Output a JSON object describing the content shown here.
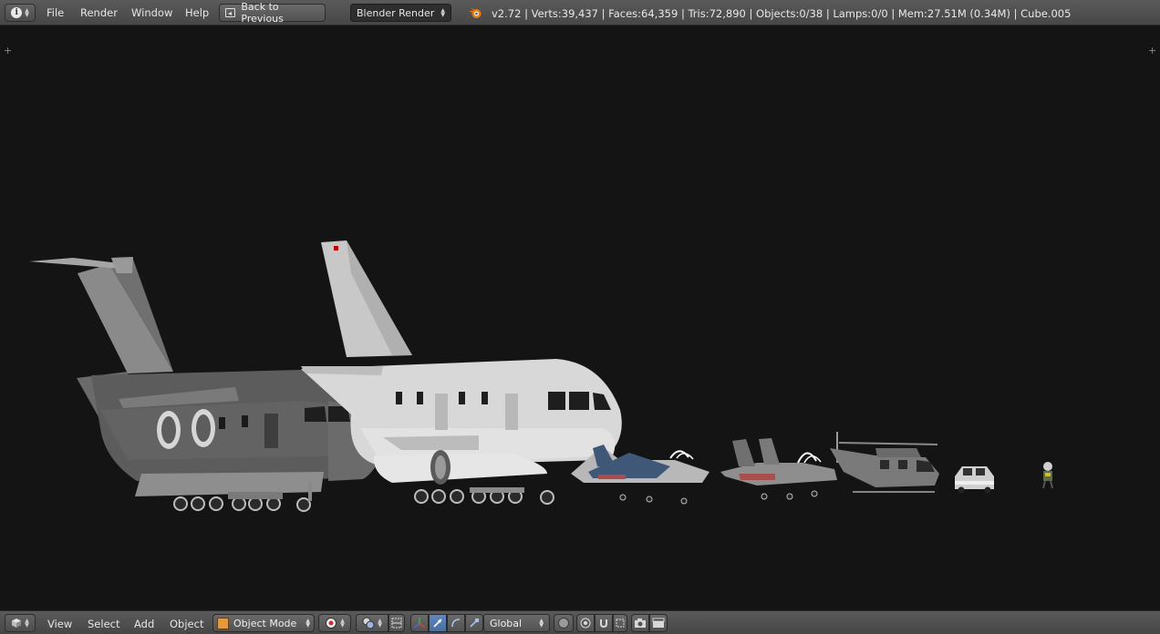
{
  "top_bar": {
    "editor_type_icon": "info-icon",
    "menus": [
      "File",
      "Render",
      "Window",
      "Help"
    ],
    "back_button_label": "Back to Previous",
    "render_engine": "Blender Render",
    "stats": "v2.72 | Verts:39,437 | Faces:64,359 | Tris:72,890 | Objects:0/38 | Lamps:0/0 | Mem:27.51M (0.34M) | Cube.005"
  },
  "viewport": {
    "objects": [
      "cargo-aircraft-dark",
      "airliner-white",
      "fighter-jet-blue",
      "fighter-jet-grey",
      "helicopter",
      "utility-vehicle",
      "pilot-figure"
    ]
  },
  "bottom_bar": {
    "editor_type_icon": "3d-view-cube-icon",
    "menus": [
      "View",
      "Select",
      "Add",
      "Object"
    ],
    "mode": "Object Mode",
    "orientation": "Global"
  },
  "colors": {
    "header_bg": "#4d4d4d",
    "viewport_bg": "#141414",
    "active_tool": "#5680c2",
    "mode_icon": "#e49a3a"
  }
}
